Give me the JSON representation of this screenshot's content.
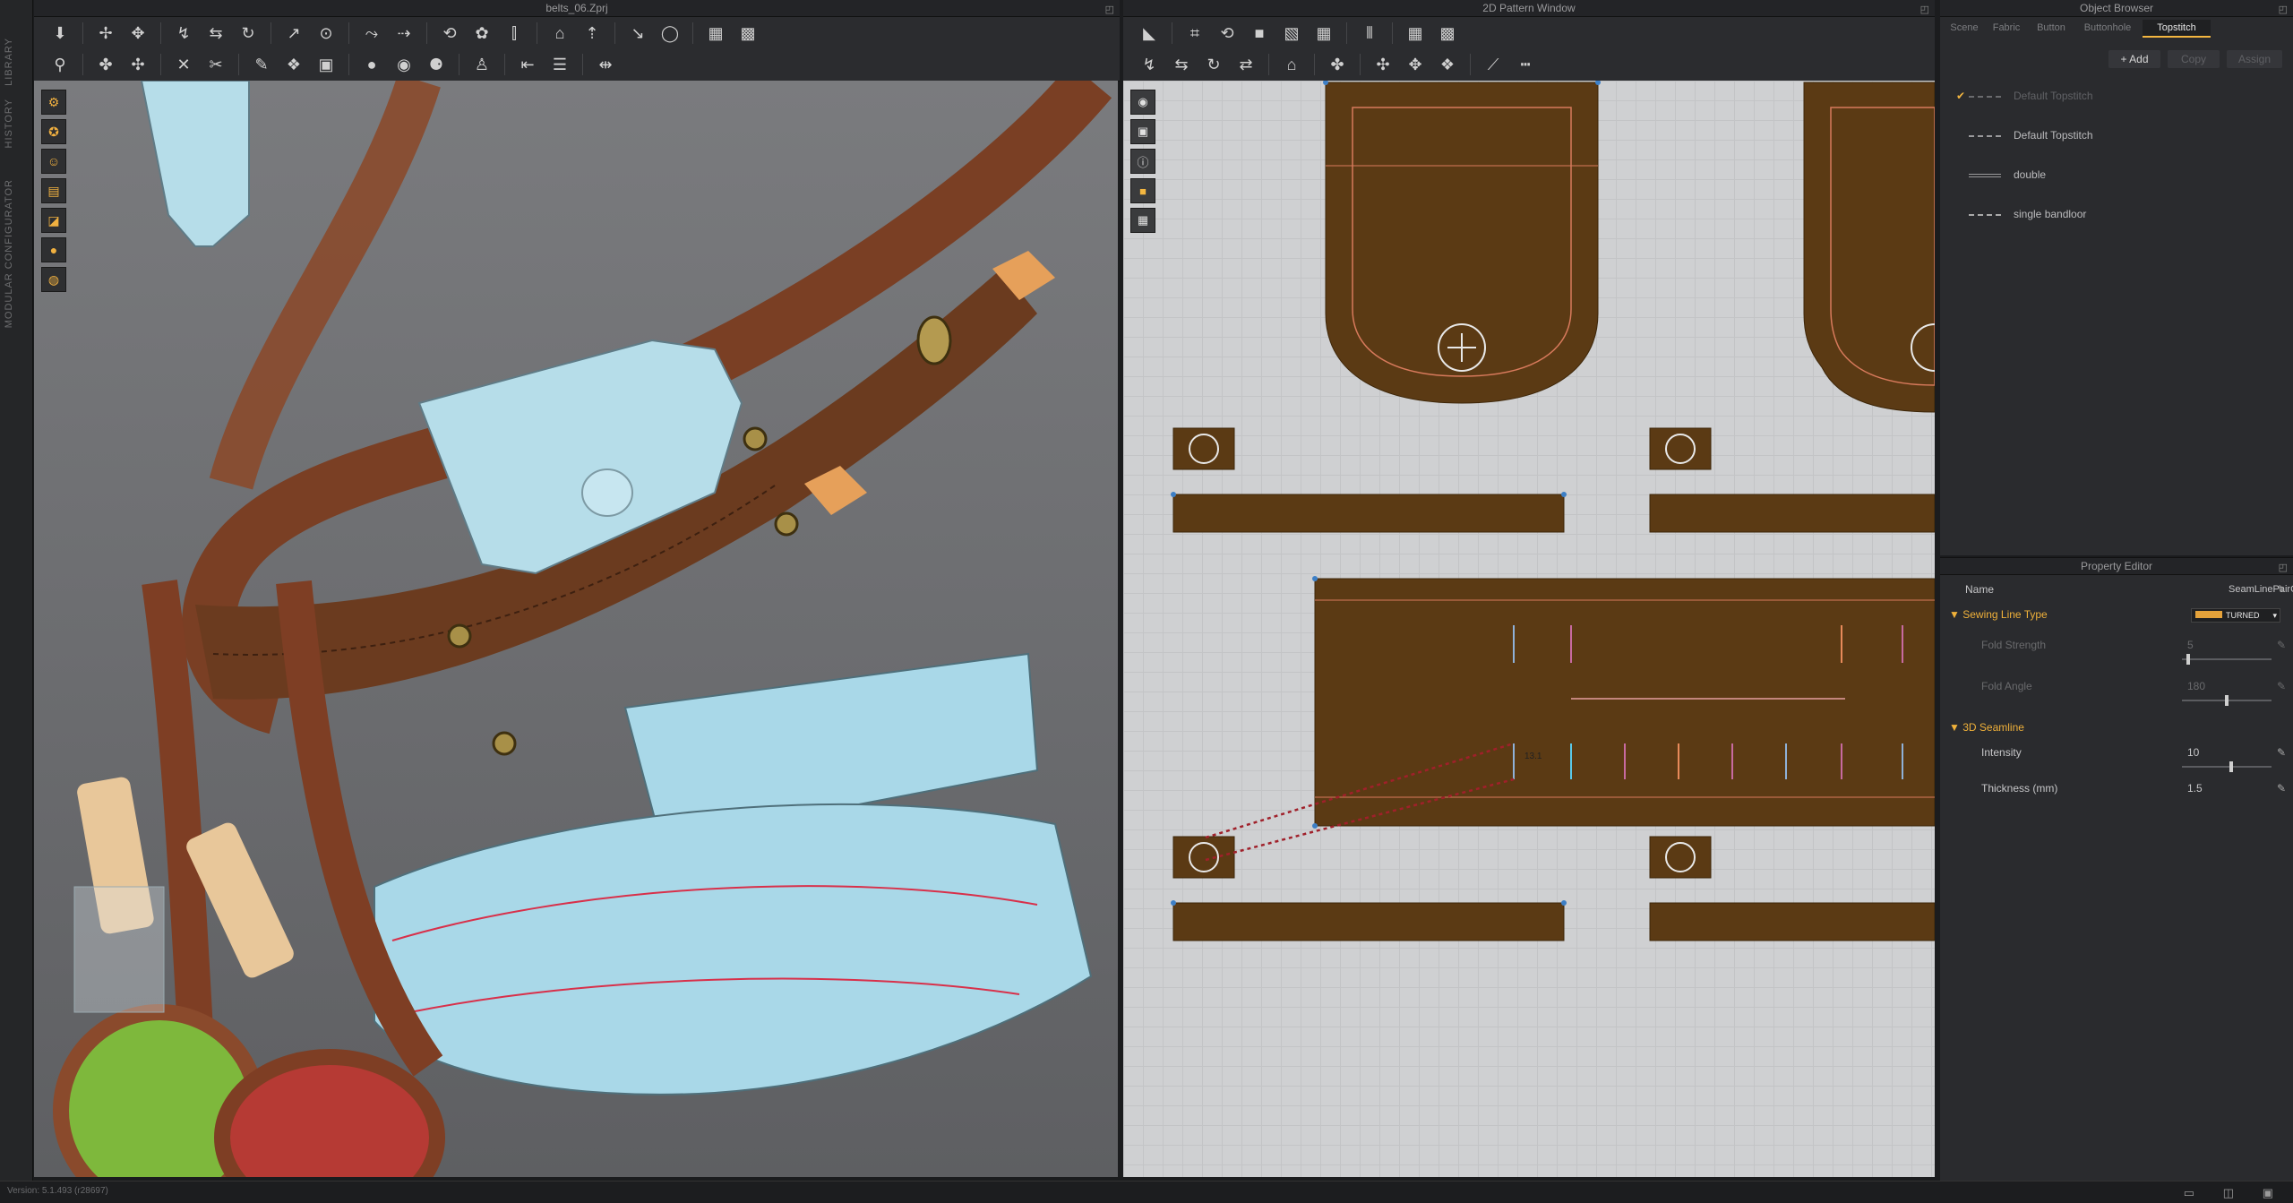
{
  "side_tabs": [
    "LIBRARY",
    "HISTORY",
    "MODULAR CONFIGURATOR"
  ],
  "viewport3d": {
    "title": "belts_06.Zprj"
  },
  "viewport2d": {
    "title": "2D Pattern Window",
    "measure_label": "13.1"
  },
  "object_browser": {
    "title": "Object Browser",
    "tabs": [
      "Scene",
      "Fabric",
      "Button",
      "Buttonhole",
      "Topstitch"
    ],
    "active_tab": "Topstitch",
    "buttons": {
      "add": "+ Add",
      "copy": "Copy",
      "assign": "Assign"
    },
    "topstitch_items": [
      {
        "name": "Default Topstitch",
        "checked": true,
        "dim": true,
        "style": "dashed"
      },
      {
        "name": "Default Topstitch",
        "checked": false,
        "dim": false,
        "style": "dashed"
      },
      {
        "name": "double",
        "checked": false,
        "dim": false,
        "style": "double"
      },
      {
        "name": "single bandloor",
        "checked": false,
        "dim": false,
        "style": "long-dash"
      }
    ]
  },
  "property_editor": {
    "title": "Property Editor",
    "name_label": "Name",
    "name_value": "SeamLinePairG",
    "sections": {
      "sewing": "Sewing Line Type",
      "seamline": "3D Seamline"
    },
    "sewing_type_value": "TURNED",
    "fold_strength": {
      "label": "Fold Strength",
      "value": "5",
      "fraction": 0.05
    },
    "fold_angle": {
      "label": "Fold Angle",
      "value": "180",
      "fraction": 0.5
    },
    "intensity": {
      "label": "Intensity",
      "value": "10",
      "fraction": 0.55
    },
    "thickness": {
      "label": "Thickness (mm)",
      "value": "1.5"
    }
  },
  "status": {
    "version": "Version: 5.1.493 (r28697)"
  },
  "colors": {
    "accent": "#f3b640",
    "leather": "#5b3a14",
    "fabric": "#a9d8e8",
    "seam": "#d8304a",
    "point": "#3d7fc6"
  }
}
